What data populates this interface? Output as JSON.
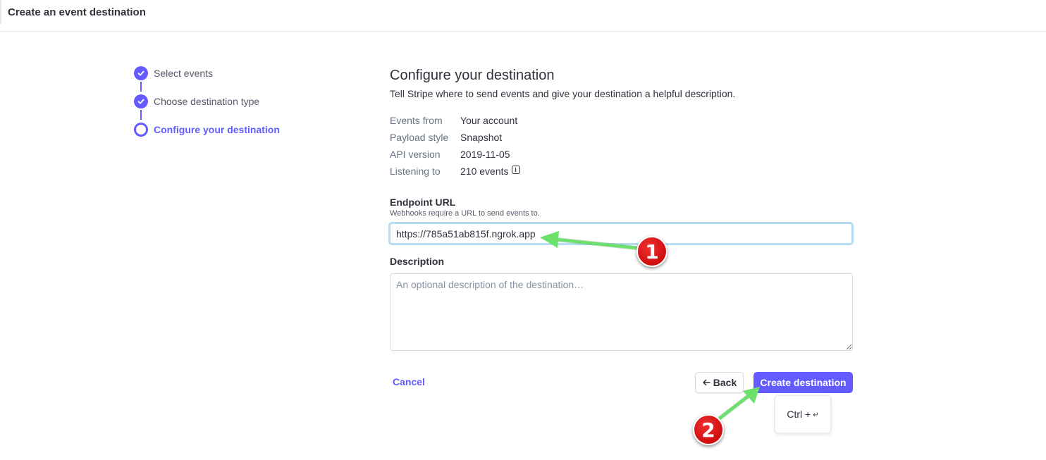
{
  "header": {
    "title": "Create an event destination"
  },
  "steps": [
    {
      "label": "Select events",
      "state": "done"
    },
    {
      "label": "Choose destination type",
      "state": "done"
    },
    {
      "label": "Configure your destination",
      "state": "current"
    }
  ],
  "main": {
    "title": "Configure your destination",
    "subtitle": "Tell Stripe where to send events and give your destination a helpful description.",
    "meta": [
      {
        "key": "Events from",
        "value": "Your account"
      },
      {
        "key": "Payload style",
        "value": "Snapshot"
      },
      {
        "key": "API version",
        "value": "2019-11-05"
      },
      {
        "key": "Listening to",
        "value": "210 events"
      }
    ],
    "endpoint": {
      "label": "Endpoint URL",
      "help": "Webhooks require a URL to send events to.",
      "value": "https://785a51ab815f.ngrok.app"
    },
    "description": {
      "label": "Description",
      "placeholder": "An optional description of the destination…"
    }
  },
  "actions": {
    "cancel": "Cancel",
    "back": "Back",
    "create": "Create destination",
    "shortcut": "Ctrl +",
    "shortcut_key": "↵"
  },
  "annotations": [
    {
      "number": "1"
    },
    {
      "number": "2"
    }
  ],
  "colors": {
    "accent": "#635bff",
    "annotation_badge": "#d10000",
    "annotation_arrow": "#5fd35f",
    "input_focus": "#b3ddf0"
  },
  "icons": {
    "step_done": "check-icon",
    "step_current": "ring-icon",
    "info": "info-icon",
    "back": "arrow-left-icon"
  }
}
